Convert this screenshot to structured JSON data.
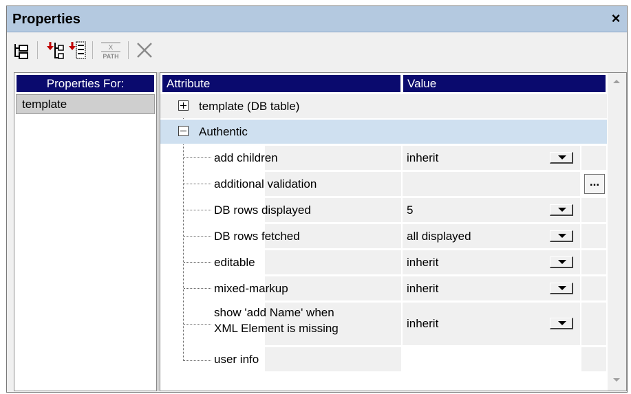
{
  "window": {
    "title": "Properties",
    "close_glyph": "×"
  },
  "toolbar": {
    "buttons": [
      {
        "name": "add-sibling-icon"
      },
      {
        "name": "add-child-before-icon"
      },
      {
        "name": "add-child-after-icon"
      },
      {
        "name": "xpath-icon",
        "label": "PATH"
      },
      {
        "name": "delete-icon"
      }
    ]
  },
  "left": {
    "header": "Properties For:",
    "selected": "template"
  },
  "grid": {
    "col_attribute": "Attribute",
    "col_value": "Value",
    "groups": [
      {
        "label": "template (DB table)",
        "expanded": false,
        "toggle": "+"
      },
      {
        "label": "Authentic",
        "expanded": true,
        "toggle": "−"
      }
    ],
    "rows": [
      {
        "attribute": "add children",
        "value": "inherit",
        "control": "dropdown"
      },
      {
        "attribute": "additional validation",
        "value": "",
        "control": "ellipsis",
        "ellipsis_label": "..."
      },
      {
        "attribute": "DB rows displayed",
        "value": "5",
        "control": "dropdown"
      },
      {
        "attribute": "DB rows fetched",
        "value": "all displayed",
        "control": "dropdown"
      },
      {
        "attribute": "editable",
        "value": "inherit",
        "control": "dropdown"
      },
      {
        "attribute": "mixed-markup",
        "value": "inherit",
        "control": "dropdown"
      },
      {
        "attribute_line1": "show 'add Name' when",
        "attribute_line2": "XML Element is missing",
        "value": "inherit",
        "control": "dropdown"
      },
      {
        "attribute": "user info",
        "value": "",
        "control": "none"
      }
    ]
  },
  "colors": {
    "title_bg": "#b4c9e0",
    "header_bg": "#0a0a6e",
    "selected_group_bg": "#cfe0f0",
    "cell_bg": "#f0f0f0"
  }
}
